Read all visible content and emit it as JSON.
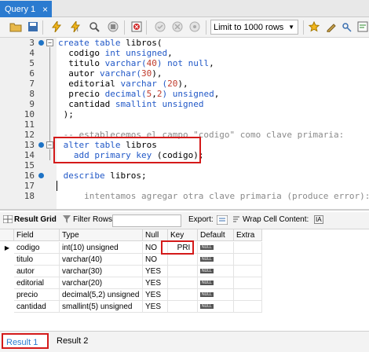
{
  "tab": {
    "label": "Query 1",
    "close": "×"
  },
  "toolbar": {
    "limit_value": "Limit to 1000 rows",
    "icons": [
      "folder-open-icon",
      "save-icon",
      "execute-icon",
      "execute-current-icon",
      "explain-icon",
      "stop-icon",
      "toggle-error-icon",
      "commit-icon",
      "rollback-icon",
      "autocommit-icon",
      "beautify-icon",
      "find-icon",
      "invisible-chars-icon",
      "wrap-icon"
    ]
  },
  "editor": {
    "lines": [
      {
        "n": "3",
        "dot": true,
        "fold": "−"
      },
      {
        "n": "4"
      },
      {
        "n": "5"
      },
      {
        "n": "6"
      },
      {
        "n": "7"
      },
      {
        "n": "8"
      },
      {
        "n": "9"
      },
      {
        "n": "10"
      },
      {
        "n": "11"
      },
      {
        "n": "12"
      },
      {
        "n": "13",
        "dot": true,
        "fold": "−"
      },
      {
        "n": "14"
      },
      {
        "n": "15"
      },
      {
        "n": "16",
        "dot": true
      },
      {
        "n": "17"
      },
      {
        "n": "18"
      }
    ],
    "code": {
      "l3_a": "create table ",
      "l3_b": "libros(",
      "l4_a": "  codigo ",
      "l4_b": "int unsigned",
      "l5_a": "  titulo ",
      "l5_b": "varchar(",
      "l5_c": "40",
      "l5_d": ") not null",
      "l6_a": "  autor ",
      "l6_b": "varchar(",
      "l6_c": "30",
      "l6_d": "),",
      "l7_a": "  editorial ",
      "l7_b": "varchar (",
      "l7_c": "20",
      "l7_d": "),",
      "l8_a": "  precio ",
      "l8_b": "decimal(",
      "l8_c": "5",
      "l8_d": ",",
      "l8_e": "2",
      "l8_f": ") unsigned",
      "l9_a": "  cantidad ",
      "l9_b": "smallint unsigned",
      "l10": " );",
      "l12": " -- establecemos el campo \"codigo\" como clave primaria:",
      "l13_a": " alter table ",
      "l13_b": "libros",
      "l14_a": "   add primary key ",
      "l14_b": "(codigo);",
      "l16_a": " describe ",
      "l16_b": "libros;",
      "l18": "     intentamos agregar otra clave primaria (produce error):"
    },
    "commas": [
      ",",
      ",",
      ",",
      ",",
      ","
    ]
  },
  "result_toolbar": {
    "result_grid": "Result Grid",
    "filter_rows": "Filter Rows:",
    "export": "Export:",
    "wrap": "Wrap Cell Content:",
    "wrap_icon": "IA"
  },
  "grid": {
    "headers": [
      "Field",
      "Type",
      "Null",
      "Key",
      "Default",
      "Extra"
    ],
    "rows": [
      {
        "field": "codigo",
        "type": "int(10) unsigned",
        "null": "NO",
        "key": "PRI",
        "default": "NULL",
        "extra": ""
      },
      {
        "field": "titulo",
        "type": "varchar(40)",
        "null": "NO",
        "key": "",
        "default": "NULL",
        "extra": ""
      },
      {
        "field": "autor",
        "type": "varchar(30)",
        "null": "YES",
        "key": "",
        "default": "NULL",
        "extra": ""
      },
      {
        "field": "editorial",
        "type": "varchar(20)",
        "null": "YES",
        "key": "",
        "default": "NULL",
        "extra": ""
      },
      {
        "field": "precio",
        "type": "decimal(5,2) unsigned",
        "null": "YES",
        "key": "",
        "default": "NULL",
        "extra": ""
      },
      {
        "field": "cantidad",
        "type": "smallint(5) unsigned",
        "null": "YES",
        "key": "",
        "default": "NULL",
        "extra": ""
      }
    ]
  },
  "bottom_tabs": {
    "result1": "Result 1",
    "result1_close": "×",
    "result2": "Result 2"
  },
  "colors": {
    "accent": "#2b7bd0",
    "highlight": "#d41a1a",
    "keyword": "#2158c7",
    "number": "#c03a2b",
    "comment": "#8a8a8a"
  }
}
